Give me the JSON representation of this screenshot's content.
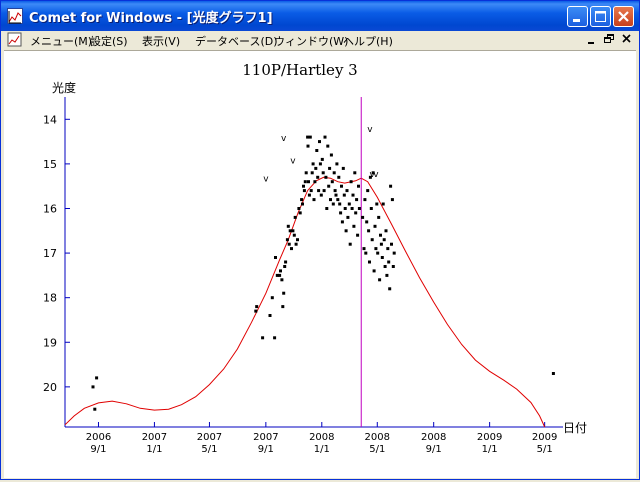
{
  "window": {
    "title": "Comet for Windows - [光度グラフ1]"
  },
  "menu": {
    "items": [
      "メニュー(M)",
      "設定(S)",
      "表示(V)",
      "データベース(D)",
      "ウィンドウ(W)",
      "ヘルプ(H)"
    ]
  },
  "colors": {
    "axis": "#0000c0",
    "curve": "#e00000",
    "marker": "#c000c0",
    "points": "#000000",
    "titlebar": "#0a5ce6"
  },
  "chart_data": {
    "type": "scatter",
    "title": "110P/Hartley 3",
    "ylabel": "光度",
    "xlabel": "日付",
    "y_inverted": true,
    "ylim": [
      20.9,
      13.5
    ],
    "xlim": [
      "2006-06-20",
      "2009-06-10"
    ],
    "y_ticks": [
      14,
      15,
      16,
      17,
      18,
      19,
      20
    ],
    "x_ticks": [
      {
        "date": "2006-09-01",
        "year": "2006",
        "md": "9/1"
      },
      {
        "date": "2007-01-01",
        "year": "2007",
        "md": "1/1"
      },
      {
        "date": "2007-05-01",
        "year": "2007",
        "md": "5/1"
      },
      {
        "date": "2007-09-01",
        "year": "2007",
        "md": "9/1"
      },
      {
        "date": "2008-01-01",
        "year": "2008",
        "md": "1/1"
      },
      {
        "date": "2008-05-01",
        "year": "2008",
        "md": "5/1"
      },
      {
        "date": "2008-09-01",
        "year": "2008",
        "md": "9/1"
      },
      {
        "date": "2009-01-01",
        "year": "2009",
        "md": "1/1"
      },
      {
        "date": "2009-05-01",
        "year": "2009",
        "md": "5/1"
      }
    ],
    "marker_date": "2008-03-27",
    "observations": [
      [
        "2006-08-20",
        20.0
      ],
      [
        "2006-08-28",
        19.8
      ],
      [
        "2006-08-24",
        20.5
      ],
      [
        "2007-08-10",
        18.3
      ],
      [
        "2007-08-12",
        18.2
      ],
      [
        "2007-08-25",
        18.9
      ],
      [
        "2007-09-10",
        18.4
      ],
      [
        "2007-09-15",
        18.0
      ],
      [
        "2007-09-20",
        18.9
      ],
      [
        "2007-09-22",
        17.1
      ],
      [
        "2007-09-26",
        17.5
      ],
      [
        "2007-10-01",
        17.5
      ],
      [
        "2007-10-03",
        17.4
      ],
      [
        "2007-10-06",
        17.6
      ],
      [
        "2007-10-08",
        18.2
      ],
      [
        "2007-10-10",
        17.9
      ],
      [
        "2007-10-12",
        17.3
      ],
      [
        "2007-10-14",
        17.2
      ],
      [
        "2007-10-18",
        16.7
      ],
      [
        "2007-10-20",
        16.4
      ],
      [
        "2007-10-22",
        16.8
      ],
      [
        "2007-10-24",
        16.5
      ],
      [
        "2007-10-27",
        16.9
      ],
      [
        "2007-10-30",
        16.5
      ],
      [
        "2007-11-02",
        16.6
      ],
      [
        "2007-11-04",
        16.2
      ],
      [
        "2007-11-06",
        16.8
      ],
      [
        "2007-11-09",
        16.7
      ],
      [
        "2007-11-12",
        16.0
      ],
      [
        "2007-11-15",
        16.1
      ],
      [
        "2007-11-18",
        15.8
      ],
      [
        "2007-11-20",
        15.9
      ],
      [
        "2007-11-22",
        15.5
      ],
      [
        "2007-11-24",
        15.6
      ],
      [
        "2007-11-26",
        15.4
      ],
      [
        "2007-11-28",
        15.2
      ],
      [
        "2007-12-01",
        14.4
      ],
      [
        "2007-12-02",
        14.6
      ],
      [
        "2007-12-03",
        15.4
      ],
      [
        "2007-12-05",
        15.7
      ],
      [
        "2007-12-07",
        14.4
      ],
      [
        "2007-12-09",
        15.6
      ],
      [
        "2007-12-11",
        15.2
      ],
      [
        "2007-12-13",
        15.0
      ],
      [
        "2007-12-15",
        15.8
      ],
      [
        "2007-12-17",
        15.4
      ],
      [
        "2007-12-19",
        15.1
      ],
      [
        "2007-12-21",
        14.7
      ],
      [
        "2007-12-23",
        15.3
      ],
      [
        "2007-12-25",
        15.6
      ],
      [
        "2007-12-27",
        14.5
      ],
      [
        "2007-12-29",
        15.0
      ],
      [
        "2007-12-31",
        15.7
      ],
      [
        "2008-01-02",
        14.9
      ],
      [
        "2008-01-04",
        15.2
      ],
      [
        "2008-01-06",
        15.6
      ],
      [
        "2008-01-08",
        14.4
      ],
      [
        "2008-01-10",
        15.3
      ],
      [
        "2008-01-12",
        16.0
      ],
      [
        "2008-01-14",
        14.6
      ],
      [
        "2008-01-16",
        15.5
      ],
      [
        "2008-01-18",
        15.1
      ],
      [
        "2008-01-20",
        15.8
      ],
      [
        "2008-01-22",
        14.8
      ],
      [
        "2008-01-24",
        15.4
      ],
      [
        "2008-01-26",
        15.9
      ],
      [
        "2008-01-28",
        15.2
      ],
      [
        "2008-01-30",
        15.6
      ],
      [
        "2008-02-01",
        15.7
      ],
      [
        "2008-02-03",
        15.0
      ],
      [
        "2008-02-05",
        15.8
      ],
      [
        "2008-02-07",
        15.3
      ],
      [
        "2008-02-09",
        15.9
      ],
      [
        "2008-02-11",
        16.1
      ],
      [
        "2008-02-13",
        15.5
      ],
      [
        "2008-02-15",
        16.3
      ],
      [
        "2008-02-17",
        15.1
      ],
      [
        "2008-02-19",
        15.7
      ],
      [
        "2008-02-21",
        16.0
      ],
      [
        "2008-02-23",
        16.5
      ],
      [
        "2008-02-25",
        15.6
      ],
      [
        "2008-02-27",
        16.2
      ],
      [
        "2008-03-01",
        15.9
      ],
      [
        "2008-03-03",
        16.8
      ],
      [
        "2008-03-05",
        15.4
      ],
      [
        "2008-03-07",
        16.0
      ],
      [
        "2008-03-09",
        15.7
      ],
      [
        "2008-03-11",
        16.4
      ],
      [
        "2008-03-13",
        15.2
      ],
      [
        "2008-03-15",
        16.1
      ],
      [
        "2008-03-17",
        15.8
      ],
      [
        "2008-03-19",
        16.6
      ],
      [
        "2008-03-21",
        15.5
      ],
      [
        "2008-03-23",
        16.0
      ],
      [
        "2008-03-30",
        16.2
      ],
      [
        "2008-04-02",
        16.9
      ],
      [
        "2008-04-04",
        15.8
      ],
      [
        "2008-04-06",
        17.0
      ],
      [
        "2008-04-08",
        16.3
      ],
      [
        "2008-04-10",
        15.6
      ],
      [
        "2008-04-12",
        16.5
      ],
      [
        "2008-04-14",
        17.2
      ],
      [
        "2008-04-16",
        15.3
      ],
      [
        "2008-04-18",
        16.0
      ],
      [
        "2008-04-20",
        16.7
      ],
      [
        "2008-04-22",
        15.2
      ],
      [
        "2008-04-24",
        17.4
      ],
      [
        "2008-04-26",
        16.4
      ],
      [
        "2008-04-28",
        16.9
      ],
      [
        "2008-04-30",
        15.9
      ],
      [
        "2008-05-02",
        17.0
      ],
      [
        "2008-05-04",
        16.2
      ],
      [
        "2008-05-06",
        17.6
      ],
      [
        "2008-05-08",
        16.6
      ],
      [
        "2008-05-10",
        16.8
      ],
      [
        "2008-05-12",
        17.1
      ],
      [
        "2008-05-14",
        15.9
      ],
      [
        "2008-05-16",
        16.7
      ],
      [
        "2008-05-18",
        17.3
      ],
      [
        "2008-05-20",
        16.5
      ],
      [
        "2008-05-22",
        17.5
      ],
      [
        "2008-05-24",
        16.9
      ],
      [
        "2008-05-26",
        17.2
      ],
      [
        "2008-05-28",
        17.8
      ],
      [
        "2008-05-30",
        15.5
      ],
      [
        "2008-06-01",
        16.8
      ],
      [
        "2008-06-03",
        15.8
      ],
      [
        "2008-06-05",
        17.3
      ],
      [
        "2008-06-07",
        17.0
      ],
      [
        "2009-05-20",
        19.7
      ]
    ],
    "upper_limits": [
      [
        "2007-09-01",
        15.3
      ],
      [
        "2007-10-10",
        14.4
      ],
      [
        "2007-10-30",
        14.9
      ],
      [
        "2008-04-15",
        14.2
      ],
      [
        "2008-04-20",
        15.2
      ],
      [
        "2008-04-28",
        15.2
      ]
    ],
    "curve": [
      [
        "2006-06-20",
        20.85
      ],
      [
        "2006-07-10",
        20.65
      ],
      [
        "2006-08-01",
        20.48
      ],
      [
        "2006-09-01",
        20.36
      ],
      [
        "2006-10-01",
        20.32
      ],
      [
        "2006-11-01",
        20.38
      ],
      [
        "2006-12-01",
        20.48
      ],
      [
        "2007-01-01",
        20.52
      ],
      [
        "2007-02-01",
        20.5
      ],
      [
        "2007-03-01",
        20.4
      ],
      [
        "2007-04-01",
        20.22
      ],
      [
        "2007-05-01",
        19.95
      ],
      [
        "2007-06-01",
        19.6
      ],
      [
        "2007-07-01",
        19.15
      ],
      [
        "2007-08-01",
        18.55
      ],
      [
        "2007-09-01",
        17.9
      ],
      [
        "2007-10-01",
        17.15
      ],
      [
        "2007-10-20",
        16.7
      ],
      [
        "2007-11-10",
        16.1
      ],
      [
        "2007-12-01",
        15.6
      ],
      [
        "2007-12-20",
        15.38
      ],
      [
        "2008-01-05",
        15.3
      ],
      [
        "2008-01-20",
        15.32
      ],
      [
        "2008-02-05",
        15.4
      ],
      [
        "2008-02-20",
        15.43
      ],
      [
        "2008-03-15",
        15.38
      ],
      [
        "2008-03-27",
        15.32
      ],
      [
        "2008-04-10",
        15.4
      ],
      [
        "2008-05-01",
        15.75
      ],
      [
        "2008-06-01",
        16.35
      ],
      [
        "2008-07-01",
        16.95
      ],
      [
        "2008-08-01",
        17.55
      ],
      [
        "2008-09-01",
        18.1
      ],
      [
        "2008-10-01",
        18.6
      ],
      [
        "2008-11-01",
        19.05
      ],
      [
        "2008-12-01",
        19.4
      ],
      [
        "2009-01-01",
        19.65
      ],
      [
        "2009-02-01",
        19.85
      ],
      [
        "2009-03-01",
        20.05
      ],
      [
        "2009-04-01",
        20.35
      ],
      [
        "2009-04-20",
        20.65
      ],
      [
        "2009-05-01",
        20.9
      ]
    ]
  }
}
